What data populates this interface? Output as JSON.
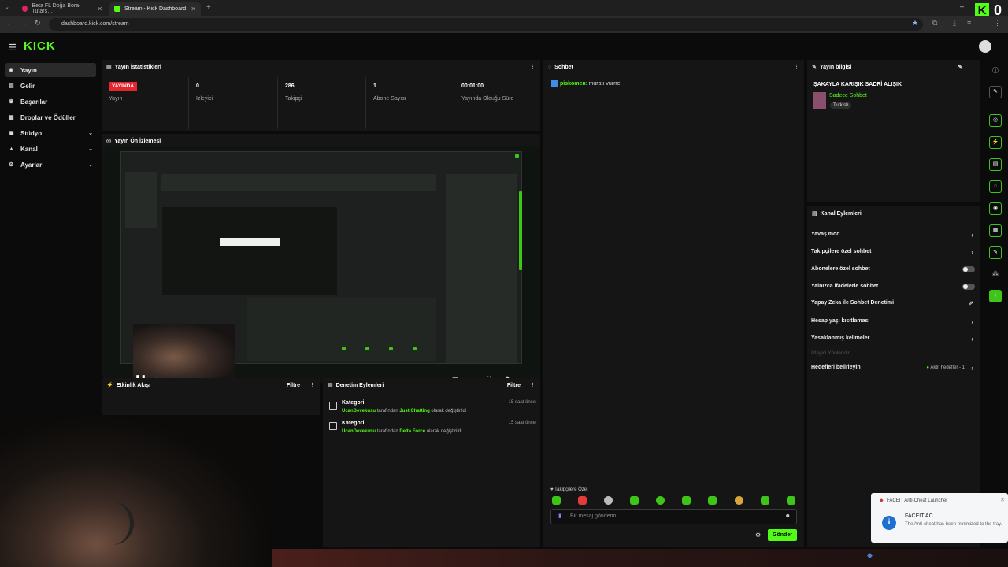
{
  "browser": {
    "tabs": [
      {
        "label": "Beta FL Doğa Bora-Tutars…",
        "active": false
      },
      {
        "label": "Stream - Kick Dashboard",
        "active": true
      }
    ],
    "url": "dashboard.kick.com/stream",
    "corner_text": "0"
  },
  "app": {
    "logo": "KICK"
  },
  "sidebar": {
    "items": [
      {
        "label": "Yayın",
        "icon": "broadcast-icon",
        "active": true
      },
      {
        "label": "Gelir",
        "icon": "wallet-icon"
      },
      {
        "label": "Başarılar",
        "icon": "trophy-icon"
      },
      {
        "label": "Droplar ve Ödüller",
        "icon": "gift-icon"
      },
      {
        "label": "Stüdyo",
        "icon": "studio-icon",
        "chevron": true
      },
      {
        "label": "Kanal",
        "icon": "channel-icon",
        "chevron": true
      },
      {
        "label": "Ayarlar",
        "icon": "gear-icon",
        "chevron": true
      }
    ]
  },
  "stats": {
    "title": "Yayın İstatistikleri",
    "live_badge": "YAYINDA",
    "live_label": "Yayın",
    "items": [
      {
        "value": "0",
        "label": "İzleyici"
      },
      {
        "value": "286",
        "label": "Takipçi"
      },
      {
        "value": "1",
        "label": "Abone Sayısı"
      },
      {
        "value": "00:01:00",
        "label": "Yayında Olduğu Süre"
      }
    ]
  },
  "preview": {
    "title": "Yayın Ön İzlemesi"
  },
  "activity": {
    "title": "Etkinlik Akışı",
    "filter": "Filtre"
  },
  "moderation": {
    "title": "Denetim Eylemleri",
    "filter": "Filtre",
    "items": [
      {
        "title": "Kategori",
        "user": "UcanDevekusu",
        "mid": "tarafından",
        "category": "Just Chatting",
        "end": "olarak değiştirildi",
        "time": "15 saat önce"
      },
      {
        "title": "Kategori",
        "user": "UcanDevekusu",
        "mid": "tarafından",
        "category": "Delta Force",
        "end": "olarak değiştirildi",
        "time": "15 saat önce"
      }
    ]
  },
  "chat": {
    "title": "Sohbet",
    "messages": [
      {
        "user": "piskomen",
        "text": "muratı vurrre"
      }
    ],
    "followers_only": "Takipçilere Özel",
    "placeholder": "Bir mesaj gönderin",
    "send": "Gönder"
  },
  "stream_info": {
    "title": "Yayın bilgisi",
    "stream_title": "ŞAKAYLA KARIŞIK SADRİ ALIŞIK",
    "category": "Sadece Sohbet",
    "language": "Turkish"
  },
  "channel_actions": {
    "title": "Kanal Eylemleri",
    "items": [
      {
        "label": "Yavaş mod",
        "control": "arrow"
      },
      {
        "label": "Takipçilere özel sohbet",
        "control": "arrow"
      },
      {
        "label": "Abonelere özel sohbet",
        "control": "toggle"
      },
      {
        "label": "Yalnızca ifadelerle sohbet",
        "control": "toggle"
      },
      {
        "label": "Yapay Zeka ile Sohbet Denetimi",
        "control": "external"
      },
      {
        "label": "Hesap yaşı kısıtlaması",
        "control": "arrow"
      },
      {
        "label": "Yasaklanmış kelimeler",
        "control": "arrow"
      }
    ],
    "section_label": "İzleyici Yönlendir",
    "targets_label": "Hedefleri belirleyin",
    "targets_status": "Aktif hedefler - 1"
  },
  "toast": {
    "app": "FACEIT Anti-Cheat Launcher",
    "title": "FACEIT AC",
    "body": "The Anti-cheat has been minimized to the tray."
  },
  "colors": {
    "accent": "#53fc18",
    "live": "#e5262e",
    "panel": "#151515",
    "background": "#0b0b0b"
  }
}
